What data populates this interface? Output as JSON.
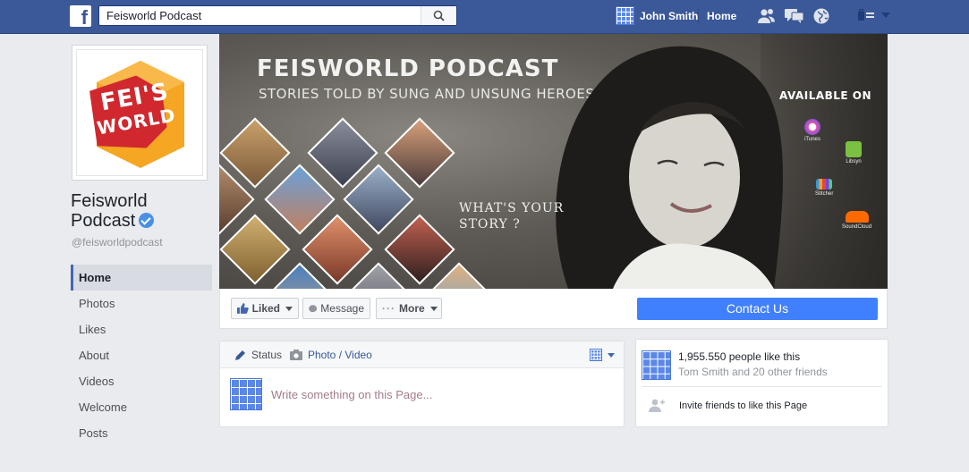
{
  "topbar": {
    "logo_letter": "f",
    "search_value": "Feisworld Podcast",
    "user_name": "John Smith",
    "home_label": "Home"
  },
  "profile": {
    "logo_line1": "FEI'S",
    "logo_line2": "WORLD",
    "name_line1": "Feisworld",
    "name_line2": "Podcast",
    "handle": "@feisworldpodcast"
  },
  "leftnav": {
    "items": [
      "Home",
      "Photos",
      "Likes",
      "About",
      "Videos",
      "Welcome",
      "Posts"
    ]
  },
  "cover": {
    "title": "FEISWORLD PODCAST",
    "subtitle": "STORIES TOLD BY SUNG AND UNSUNG HEROES",
    "tagline_line1": "WHAT'S YOUR",
    "tagline_line2": "STORY ?",
    "available_on": "AVAILABLE ON",
    "platforms": [
      "iTunes",
      "Libsyn",
      "Stitcher",
      "SoundCloud"
    ]
  },
  "actions": {
    "liked": "Liked",
    "message": "Message",
    "more": "More",
    "contact": "Contact Us"
  },
  "composer": {
    "status": "Status",
    "photo_video": "Photo / Video",
    "placeholder": "Write something on this Page..."
  },
  "likes_panel": {
    "count_text": "1,955.550 people like this",
    "friends_text": "Tom Smith and 20 other friends",
    "invite_text": "Invite friends to like this Page"
  },
  "colors": {
    "topbar": "#3b5998",
    "accent": "#4080ff",
    "logo_orange": "#f5a623",
    "logo_red": "#d0282e"
  }
}
